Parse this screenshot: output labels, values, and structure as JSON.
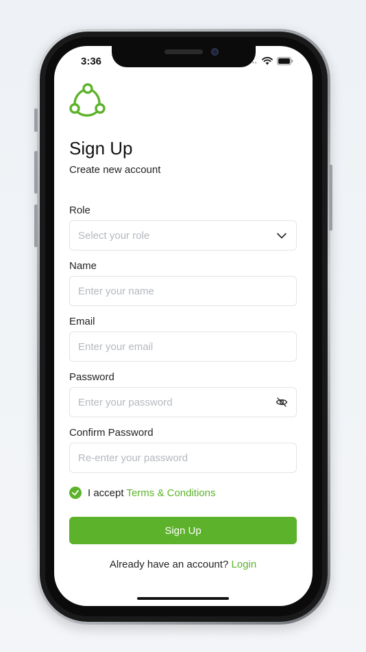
{
  "status_bar": {
    "time": "3:36"
  },
  "header": {
    "title": "Sign Up",
    "subtitle": "Create new account"
  },
  "form": {
    "role": {
      "label": "Role",
      "placeholder": "Select your role"
    },
    "name": {
      "label": "Name",
      "placeholder": "Enter your name"
    },
    "email": {
      "label": "Email",
      "placeholder": "Enter your email"
    },
    "password": {
      "label": "Password",
      "placeholder": "Enter your password"
    },
    "confirm_password": {
      "label": "Confirm Password",
      "placeholder": "Re-enter your password"
    }
  },
  "terms": {
    "checked": true,
    "prefix": "I accept",
    "link": "Terms & Conditions"
  },
  "submit_label": "Sign Up",
  "footer": {
    "prompt": "Already have an account?",
    "link": "Login"
  },
  "colors": {
    "accent": "#5db22b",
    "text": "#222222",
    "placeholder": "#b4b8be",
    "border": "#e2e4e8"
  },
  "icons": [
    "logo-icon",
    "chevron-down-icon",
    "eye-off-icon",
    "check-icon",
    "wifi-icon",
    "battery-icon"
  ]
}
